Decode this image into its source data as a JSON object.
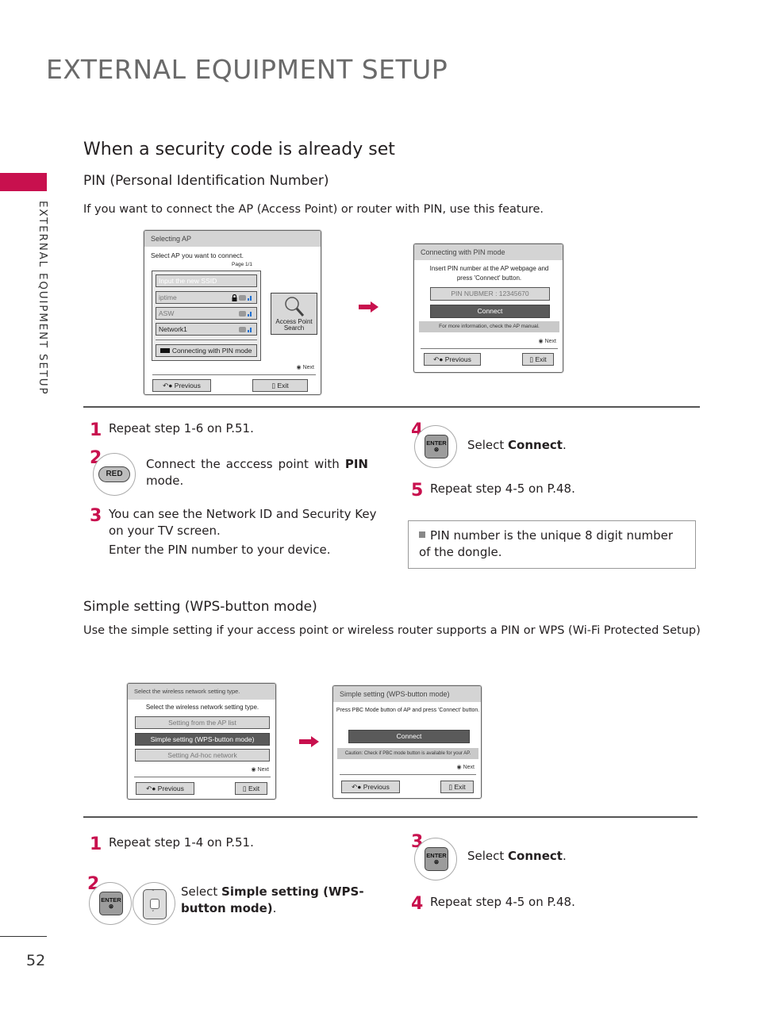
{
  "header": {
    "title": "EXTERNAL EQUIPMENT SETUP",
    "side_label": "EXTERNAL EQUIPMENT SETUP",
    "accent": "#c8104e"
  },
  "section": {
    "title": "When a security code is already set"
  },
  "pin": {
    "heading": "PIN (Personal Identification Number)",
    "intro": "If you want to connect the AP (Access Point) or router with PIN, use this feature.",
    "screen1": {
      "title": "Selecting AP",
      "instruction": "Select AP you want to connect.",
      "page": "Page 1/1",
      "items": [
        {
          "label": "Input the new SSID",
          "selected": true
        },
        {
          "label": "iptime",
          "locked": true
        },
        {
          "label": "ASW",
          "locked": false
        },
        {
          "label": "Network1",
          "locked": false
        }
      ],
      "pin_mode_label": "Connecting with PIN mode",
      "search_label_1": "Access Point",
      "search_label_2": "Search",
      "next": "Next",
      "previous": "Previous",
      "exit": "Exit"
    },
    "screen2": {
      "title": "Connecting with PIN mode",
      "instruction_1": "Insert PIN number at the AP webpage and",
      "instruction_2": "press 'Connect' button.",
      "pin_field": "PIN NUBMER : 12345670",
      "connect": "Connect",
      "note": "For more information, check the AP manual.",
      "next": "Next",
      "previous": "Previous",
      "exit": "Exit"
    },
    "steps": [
      {
        "num": "1",
        "text": "Repeat step 1-6 on P.51."
      },
      {
        "num": "2",
        "key": "RED",
        "text_pre": "Connect the acccess point with ",
        "text_bold": "PIN",
        "text_post": " mode."
      },
      {
        "num": "3",
        "text": "You can see the Network ID and Security Key on your TV screen.",
        "text2": "Enter the PIN number to your device."
      },
      {
        "num": "4",
        "key": "ENTER",
        "text_pre": "Select ",
        "text_bold": "Connect",
        "text_post": "."
      },
      {
        "num": "5",
        "text": "Repeat step 4-5 on P.48."
      }
    ],
    "note": "PIN number is the unique 8 digit number of the dongle."
  },
  "wps": {
    "heading": "Simple setting (WPS-button mode)",
    "intro": "Use the simple setting if your access point or wireless router supports a PIN or WPS (Wi-Fi Protected Setup)",
    "screen1": {
      "title": "Select the wireless network setting type.",
      "instruction": "Select the wireless network setting type.",
      "options": [
        "Setting from the AP list",
        "Simple setting (WPS-button mode)",
        "Setting Ad-hoc network"
      ],
      "selected_index": 1,
      "next": "Next",
      "previous": "Previous",
      "exit": "Exit"
    },
    "screen2": {
      "title": "Simple setting (WPS-button mode)",
      "instruction": "Press PBC Mode button of AP and press 'Connect' button.",
      "connect": "Connect",
      "note": "Caution: Check if PBC mode button is available for your AP.",
      "next": "Next",
      "previous": "Previous",
      "exit": "Exit"
    },
    "steps": [
      {
        "num": "1",
        "text": "Repeat step 1-4 on P.51."
      },
      {
        "num": "2",
        "key": "ENTER",
        "text_pre": "Select ",
        "text_bold": "Simple setting (WPS-button mode)",
        "text_post": "."
      },
      {
        "num": "3",
        "key": "ENTER",
        "text_pre": "Select ",
        "text_bold": "Connect",
        "text_post": "."
      },
      {
        "num": "4",
        "text": "Repeat step 4-5 on P.48."
      }
    ]
  },
  "enter_key_label": "ENTER",
  "page_number": "52"
}
